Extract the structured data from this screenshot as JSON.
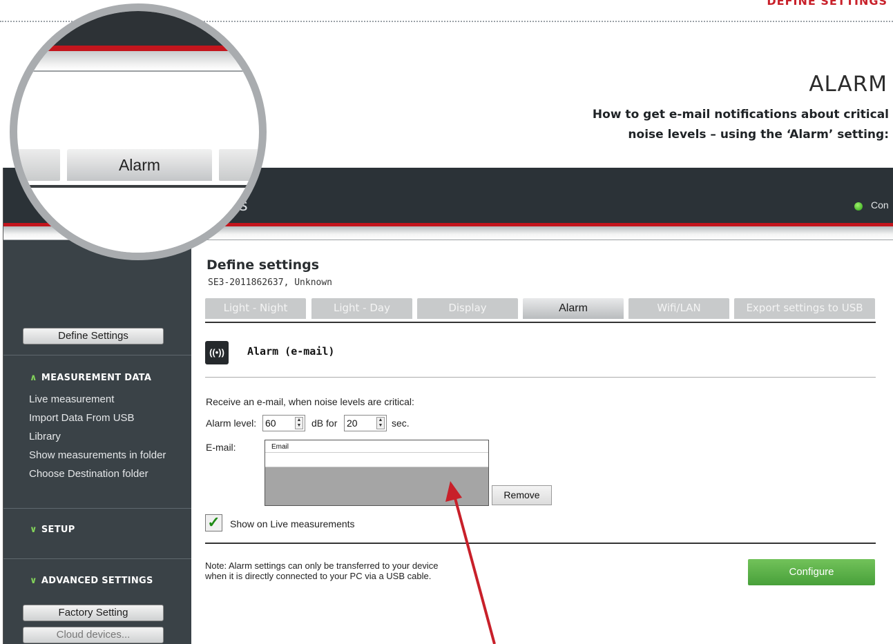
{
  "manual": {
    "section": "DEFINE SETTINGS",
    "title": "ALARM",
    "subtitle_line1": "How to get e-mail notifications about critical",
    "subtitle_line2": "noise levels – using the ‘Alarm’ setting:"
  },
  "app": {
    "brand_fragment": "gs",
    "connection_label": "Con",
    "connection_color": "#2aa215",
    "accent_red": "#c3151d"
  },
  "sidebar": {
    "define_settings_button": "Define Settings",
    "measurement_heading": "MEASUREMENT DATA",
    "measurement_items": [
      "Live measurement",
      "Import Data From USB",
      "Library",
      "Show measurements in folder",
      "Choose Destination folder"
    ],
    "setup_heading": "SETUP",
    "advanced_heading": "ADVANCED SETTINGS",
    "factory_button": "Factory Setting",
    "cloud_button": "Cloud devices..."
  },
  "main": {
    "title": "Define settings",
    "device": "SE3-2011862637, Unknown",
    "tabs": [
      "Light - Night",
      "Light - Day",
      "Display",
      "Alarm",
      "Wifi/LAN",
      "Export settings to USB"
    ],
    "active_tab": "Alarm",
    "section_icon": "alarm-broadcast-icon",
    "section_icon_glyph": "((•))",
    "section_title": "Alarm (e-mail)",
    "intro": "Receive an e-mail, when noise levels are critical:",
    "alarm_level_label": "Alarm level:",
    "alarm_level_value": "60",
    "db_for_label": "dB for",
    "duration_value": "20",
    "sec_label": "sec.",
    "email_label": "E-mail:",
    "email_column_header": "Email",
    "remove_button": "Remove",
    "show_live_label": "Show on Live measurements",
    "show_live_checked": true,
    "note_line1": "Note: Alarm settings can only be transferred to your device",
    "note_line2": "when it is directly connected to your PC via a USB cable.",
    "configure_button": "Configure",
    "configure_color": "#48a03a"
  },
  "magnifier": {
    "tab_label": "Alarm"
  }
}
